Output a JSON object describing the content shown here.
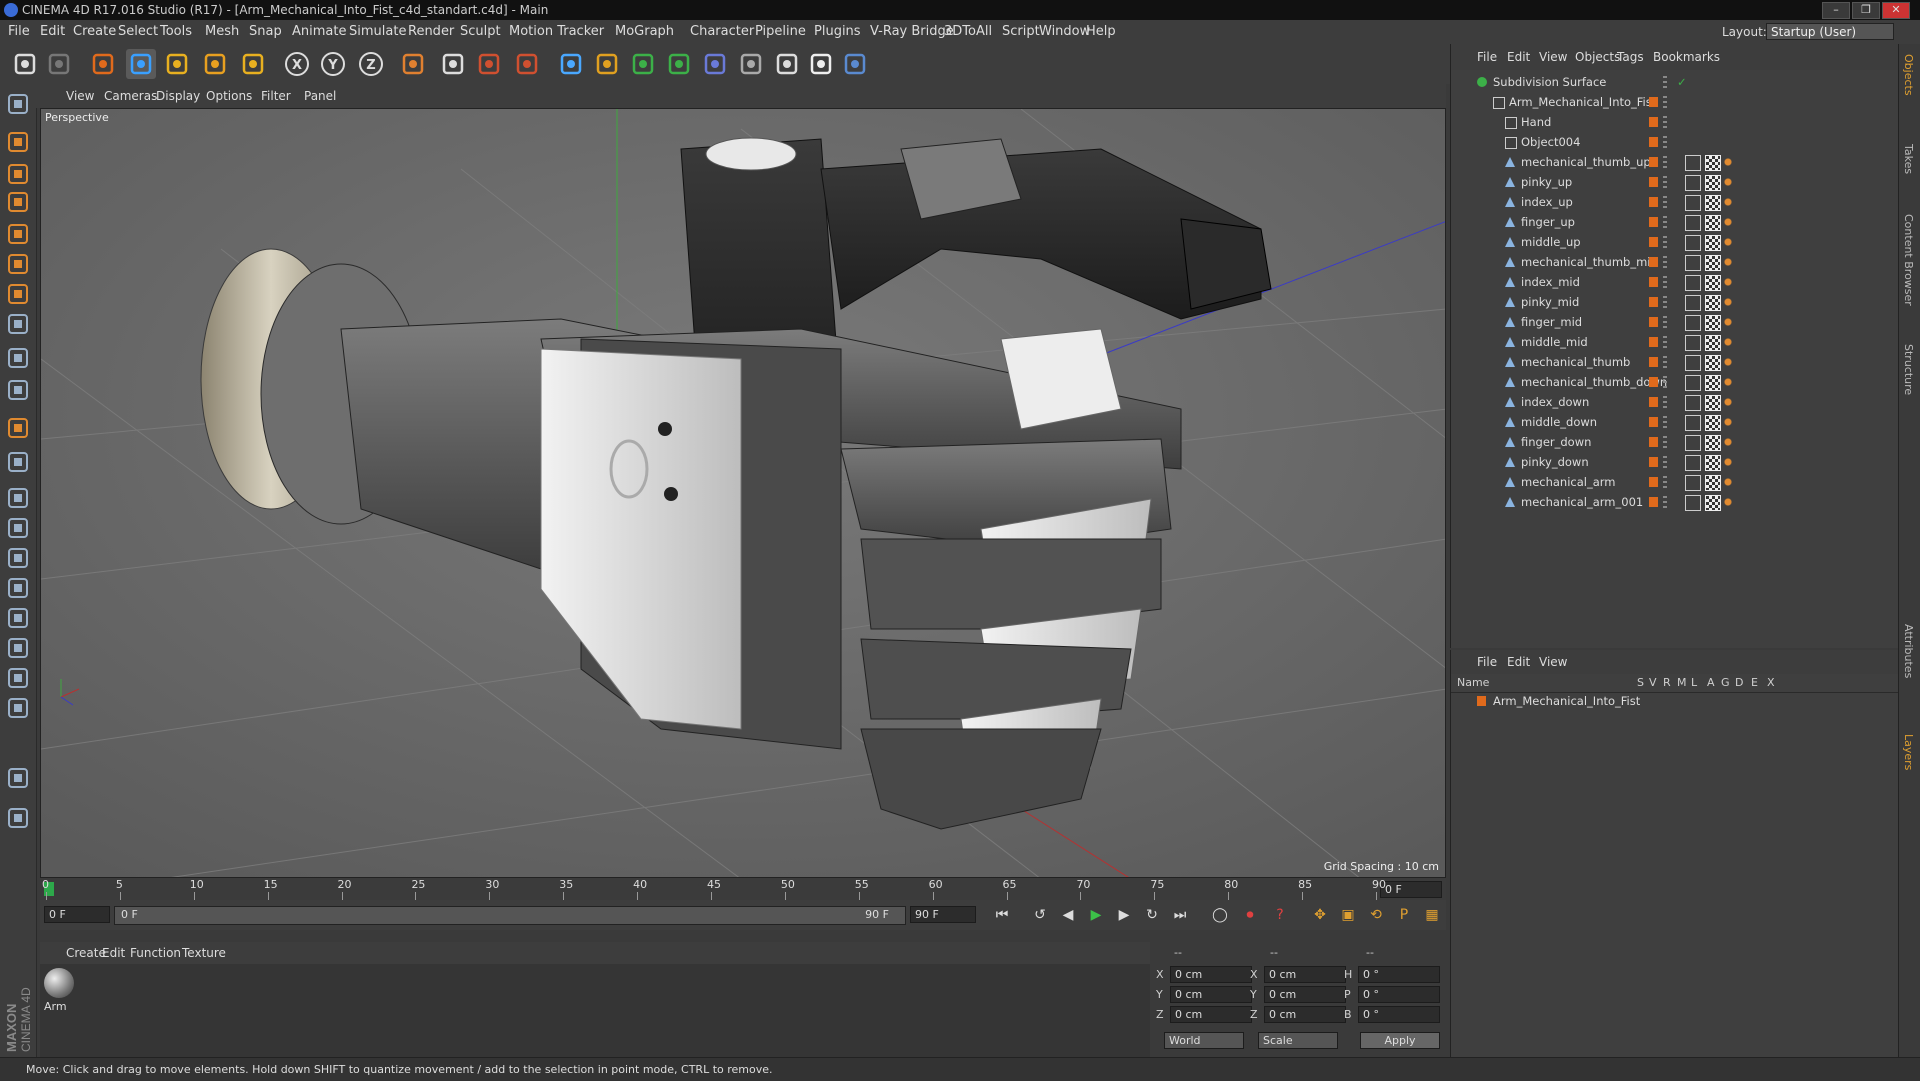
{
  "window": {
    "title": "CINEMA 4D R17.016 Studio (R17) - [Arm_Mechanical_Into_Fist_c4d_standart.c4d] - Main",
    "controls": [
      "–",
      "❐",
      "✕"
    ]
  },
  "menubar": {
    "items": [
      "File",
      "Edit",
      "Create",
      "Select",
      "Tools",
      "Mesh",
      "Snap",
      "Animate",
      "Simulate",
      "Render",
      "Sculpt",
      "Motion Tracker",
      "MoGraph",
      "Character",
      "Pipeline",
      "Plugins",
      "V-Ray Bridge",
      "3DToAll",
      "Script",
      "Window",
      "Help"
    ],
    "layout_label": "Layout:",
    "layout_value": "Startup (User)"
  },
  "toolbar": {
    "icons": [
      "undo-icon",
      "redo-icon",
      "live-selection-icon",
      "move-icon",
      "scale-icon",
      "rotate-icon",
      "move-alt-icon",
      "x-axis-icon",
      "y-axis-icon",
      "z-axis-icon",
      "coordinate-system-icon",
      "render-view-icon",
      "render-picture-viewer-icon",
      "edit-render-settings-icon",
      "cube-icon",
      "spline-pen-icon",
      "subdivision-icon",
      "array-icon",
      "deformer-icon",
      "floor-icon",
      "camera-icon",
      "light-icon",
      "python-icon"
    ]
  },
  "viewport": {
    "menu": [
      "View",
      "Cameras",
      "Display",
      "Options",
      "Filter",
      "Panel"
    ],
    "label": "Perspective",
    "grid_spacing": "Grid Spacing : 10 cm"
  },
  "timeline": {
    "ticks": [
      "0",
      "5",
      "10",
      "15",
      "20",
      "25",
      "30",
      "35",
      "40",
      "45",
      "50",
      "55",
      "60",
      "65",
      "70",
      "75",
      "80",
      "85",
      "90"
    ],
    "current_frame": "0 F",
    "start_field": "0 F",
    "range_start": "0 F",
    "range_end": "90 F",
    "end_field": "90 F"
  },
  "materials": {
    "menu": [
      "Create",
      "Edit",
      "Function",
      "Texture"
    ],
    "items": [
      {
        "label": "Arm"
      }
    ]
  },
  "coordinates": {
    "headers": [
      "--",
      "--",
      "--"
    ],
    "rows": [
      {
        "a": "X",
        "av": "0 cm",
        "b": "X",
        "bv": "0 cm",
        "c": "H",
        "cv": "0 °"
      },
      {
        "a": "Y",
        "av": "0 cm",
        "b": "Y",
        "bv": "0 cm",
        "c": "P",
        "cv": "0 °"
      },
      {
        "a": "Z",
        "av": "0 cm",
        "b": "Z",
        "bv": "0 cm",
        "c": "B",
        "cv": "0 °"
      }
    ],
    "mode": "World",
    "scale": "Scale",
    "apply": "Apply"
  },
  "status": "Move: Click and drag to move elements. Hold down SHIFT to quantize movement / add to the selection in point mode, CTRL to remove.",
  "objects_panel": {
    "menu": [
      "File",
      "Edit",
      "View",
      "Objects",
      "Tags",
      "Bookmarks"
    ],
    "items": [
      {
        "name": "Subdivision Surface",
        "level": 0,
        "type": "subdivision"
      },
      {
        "name": "Arm_Mechanical_Into_Fist",
        "level": 1,
        "type": "null"
      },
      {
        "name": "Hand",
        "level": 2,
        "type": "null"
      },
      {
        "name": "Object004",
        "level": 2,
        "type": "null"
      },
      {
        "name": "mechanical_thumb_up",
        "level": 2,
        "type": "poly"
      },
      {
        "name": "pinky_up",
        "level": 2,
        "type": "poly"
      },
      {
        "name": "index_up",
        "level": 2,
        "type": "poly"
      },
      {
        "name": "finger_up",
        "level": 2,
        "type": "poly"
      },
      {
        "name": "middle_up",
        "level": 2,
        "type": "poly"
      },
      {
        "name": "mechanical_thumb_mid",
        "level": 2,
        "type": "poly"
      },
      {
        "name": "index_mid",
        "level": 2,
        "type": "poly"
      },
      {
        "name": "pinky_mid",
        "level": 2,
        "type": "poly"
      },
      {
        "name": "finger_mid",
        "level": 2,
        "type": "poly"
      },
      {
        "name": "middle_mid",
        "level": 2,
        "type": "poly"
      },
      {
        "name": "mechanical_thumb",
        "level": 2,
        "type": "poly"
      },
      {
        "name": "mechanical_thumb_down",
        "level": 2,
        "type": "poly"
      },
      {
        "name": "index_down",
        "level": 2,
        "type": "poly"
      },
      {
        "name": "middle_down",
        "level": 2,
        "type": "poly"
      },
      {
        "name": "finger_down",
        "level": 2,
        "type": "poly"
      },
      {
        "name": "pinky_down",
        "level": 2,
        "type": "poly"
      },
      {
        "name": "mechanical_arm",
        "level": 2,
        "type": "poly"
      },
      {
        "name": "mechanical_arm_001",
        "level": 2,
        "type": "poly"
      }
    ]
  },
  "layers_panel": {
    "menu": [
      "File",
      "Edit",
      "View"
    ],
    "columns": [
      "Name",
      "S",
      "V",
      "R",
      "M",
      "L",
      "A",
      "G",
      "D",
      "E",
      "X"
    ],
    "rows": [
      {
        "name": "Arm_Mechanical_Into_Fist"
      }
    ]
  },
  "right_tabs": [
    "Objects",
    "Takes",
    "Content Browser",
    "Structure",
    "Attributes",
    "Layers"
  ],
  "brand": {
    "line1": "MAXON",
    "line2": "CINEMA 4D"
  },
  "colors": {
    "accent_orange": "#e06a1c",
    "panel": "#3d3d3d",
    "viewport_bg": "#6a6a6a"
  }
}
